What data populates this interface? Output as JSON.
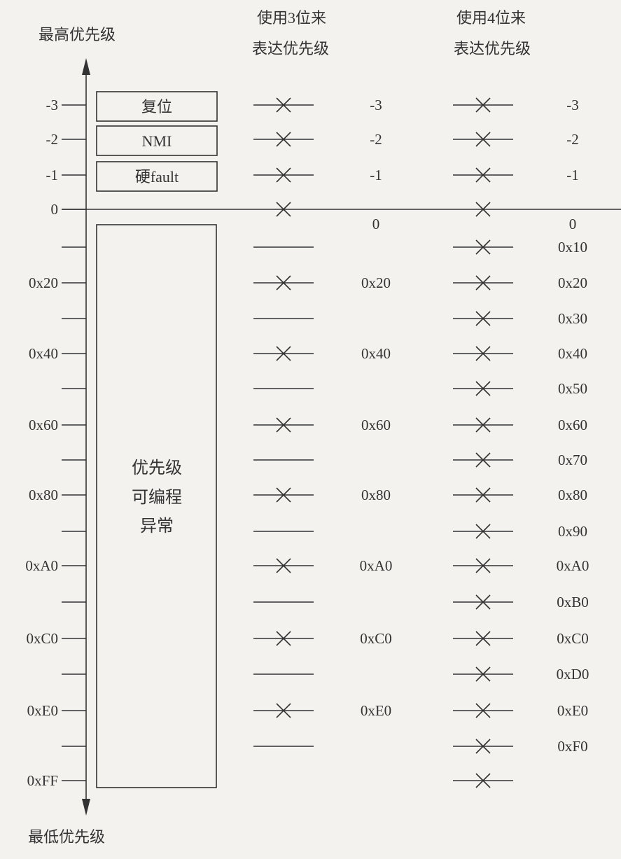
{
  "axis": {
    "top_label": "最高优先级",
    "bottom_label": "最低优先级",
    "levels": [
      {
        "label": "-3",
        "value": -3
      },
      {
        "label": "-2",
        "value": -2
      },
      {
        "label": "-1",
        "value": -1
      },
      {
        "label": "0",
        "value": 0
      },
      {
        "label": "",
        "value": 16
      },
      {
        "label": "0x20",
        "value": 32
      },
      {
        "label": "",
        "value": 48
      },
      {
        "label": "0x40",
        "value": 64
      },
      {
        "label": "",
        "value": 80
      },
      {
        "label": "0x60",
        "value": 96
      },
      {
        "label": "",
        "value": 112
      },
      {
        "label": "0x80",
        "value": 128
      },
      {
        "label": "",
        "value": 144
      },
      {
        "label": "0xA0",
        "value": 160
      },
      {
        "label": "",
        "value": 176
      },
      {
        "label": "0xC0",
        "value": 192
      },
      {
        "label": "",
        "value": 208
      },
      {
        "label": "0xE0",
        "value": 224
      },
      {
        "label": "",
        "value": 240
      },
      {
        "label": "0xFF",
        "value": 255
      }
    ]
  },
  "boxes": {
    "reset": "复位",
    "nmi": "NMI",
    "hardfault": "硬fault",
    "programmable": [
      "优先级",
      "可编程",
      "异常"
    ]
  },
  "columns": {
    "bits3": {
      "header": [
        "使用3位来",
        "表达优先级"
      ],
      "marks": [
        true,
        true,
        true,
        true,
        false,
        true,
        false,
        true,
        false,
        true,
        false,
        true,
        false,
        true,
        false,
        true,
        false,
        true,
        false
      ],
      "labels": [
        "-3",
        "-2",
        "-1",
        "0",
        "",
        "0x20",
        "",
        "0x40",
        "",
        "0x60",
        "",
        "0x80",
        "",
        "0xA0",
        "",
        "0xC0",
        "",
        "0xE0",
        ""
      ]
    },
    "bits4": {
      "header": [
        "使用4位来",
        "表达优先级"
      ],
      "marks": [
        true,
        true,
        true,
        true,
        true,
        true,
        true,
        true,
        true,
        true,
        true,
        true,
        true,
        true,
        true,
        true,
        true,
        true,
        true,
        true
      ],
      "labels": [
        "-3",
        "-2",
        "-1",
        "0",
        "0x10",
        "0x20",
        "0x30",
        "0x40",
        "0x50",
        "0x60",
        "0x70",
        "0x80",
        "0x90",
        "0xA0",
        "0xB0",
        "0xC0",
        "0xD0",
        "0xE0",
        "0xF0",
        ""
      ]
    }
  },
  "colors": {
    "ink": "#333333",
    "background": "#f3f2ee"
  }
}
